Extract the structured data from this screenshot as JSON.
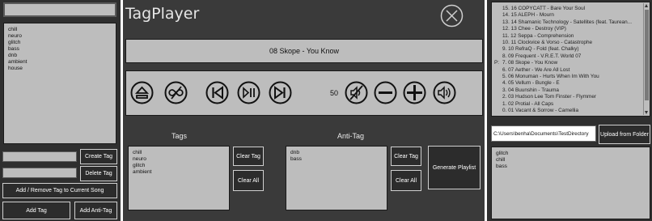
{
  "app": {
    "title": "TagPlayer",
    "close_icon": "close-circle-icon"
  },
  "left_panel": {
    "top_input_value": "",
    "tag_list": [
      "chill",
      "neuro",
      "glitch",
      "bass",
      "dnb",
      "ambient",
      "house"
    ],
    "create_tag_input_value": "",
    "delete_tag_input_value": "",
    "create_tag_label": "Create Tag",
    "delete_tag_label": "Delete Tag",
    "add_remove_label": "Add / Remove Tag to Current Song",
    "add_tag_label": "Add Tag",
    "add_anti_tag_label": "Add Anti-Tag"
  },
  "now_playing": "08 Skope - You Know",
  "controls": {
    "volume": "50",
    "icons": [
      "eject-icon",
      "no-loop-icon",
      "previous-icon",
      "play-pause-icon",
      "next-icon",
      "mute-icon",
      "volume-down-icon",
      "volume-up-icon",
      "speaker-icon"
    ]
  },
  "tags_section": {
    "heading": "Tags",
    "items": [
      "chill",
      "neuro",
      "glitch",
      "ambient"
    ],
    "clear_tag_label": "Clear Tag",
    "clear_all_label": "Clear All"
  },
  "anti_tag_section": {
    "heading": "Anti-Tag",
    "items": [
      "dnb",
      "bass"
    ],
    "clear_tag_label": "Clear Tag",
    "clear_all_label": "Clear All"
  },
  "generate_playlist_label": "Generate Playlist",
  "right_panel": {
    "playlist": [
      {
        "marker": "",
        "text": "15. 16 COPYCATT - Bare Your Soul"
      },
      {
        "marker": "",
        "text": "14. 15 ALEPH - Mourn"
      },
      {
        "marker": "",
        "text": "13. 14 Shamanic Technology - Satellites (feat. Taurean..."
      },
      {
        "marker": "",
        "text": "12. 13 Chee - Destroy (VIP)"
      },
      {
        "marker": "",
        "text": "11. 12 Seppa - Comprehension"
      },
      {
        "marker": "",
        "text": "10. 11 Clockvice & Vorso - Catastrophe"
      },
      {
        "marker": "",
        "text": "9. 10 RefraQ - Fold (feat. Chalky)"
      },
      {
        "marker": "",
        "text": "8. 09 Frequent - V.R.E.T. World 07"
      },
      {
        "marker": "P:",
        "text": "7. 08 Skope - You Know"
      },
      {
        "marker": "",
        "text": "6. 07 Aether - We Are All Lost"
      },
      {
        "marker": "",
        "text": "5. 06 Monuman - Hurts When Im With You"
      },
      {
        "marker": "",
        "text": "4. 05 Vellum - Bungle - E"
      },
      {
        "marker": "",
        "text": "3. 04 Buunshin - Trauma"
      },
      {
        "marker": "",
        "text": "2. 03 Hudson Lee Tom Finster - Flymmer"
      },
      {
        "marker": "",
        "text": "1. 02 Protial - All Caps"
      },
      {
        "marker": "",
        "text": "0. 01 Vacant & Sorrow - Camellia"
      }
    ],
    "folder_path": "C:\\Users\\benha\\Documents\\TestDirectory",
    "upload_label": "Upload from Folder",
    "song_tags": [
      "glitch",
      "chill",
      "bass"
    ]
  }
}
